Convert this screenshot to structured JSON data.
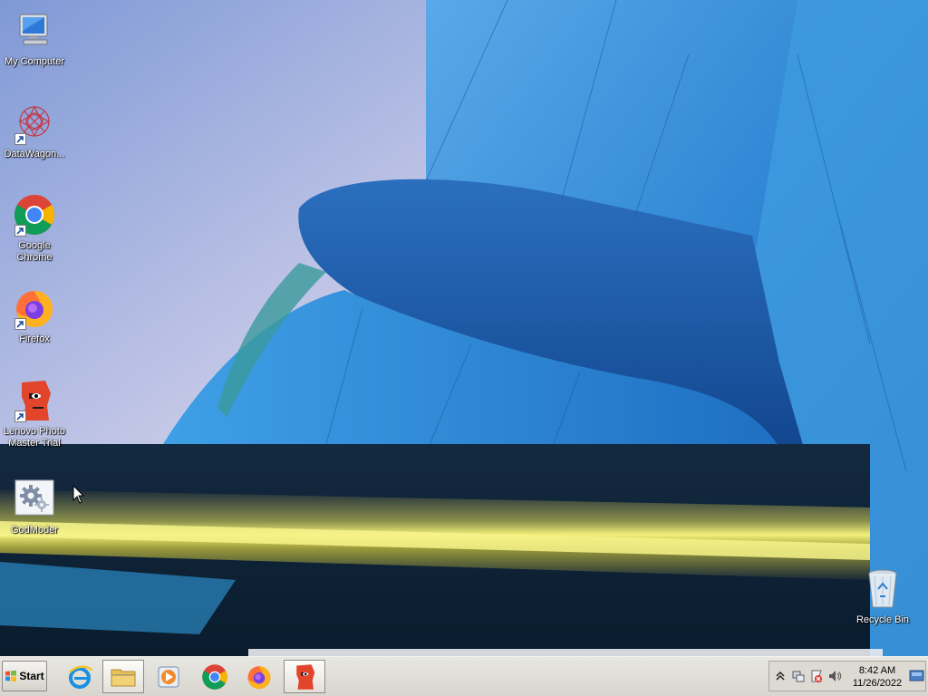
{
  "desktop": {
    "icons": [
      {
        "label": "My Computer",
        "icon": "computer-icon"
      },
      {
        "label": "DataWagon...",
        "icon": "datawagon-icon"
      },
      {
        "label": "Google Chrome",
        "icon": "chrome-icon"
      },
      {
        "label": "Firefox",
        "icon": "firefox-icon"
      },
      {
        "label": "Lenovo Photo Master Trial",
        "icon": "lenovo-photo-master-icon"
      },
      {
        "label": "GodModer",
        "icon": "settings-gears-icon"
      },
      {
        "label": "Recycle Bin",
        "icon": "recycle-bin-icon"
      }
    ]
  },
  "taskbar": {
    "start_label": "Start",
    "pinned": [
      {
        "name": "internet-explorer",
        "icon": "internet-explorer-icon"
      },
      {
        "name": "file-explorer",
        "icon": "folder-icon"
      },
      {
        "name": "media-player",
        "icon": "media-player-icon"
      },
      {
        "name": "google-chrome",
        "icon": "chrome-icon"
      },
      {
        "name": "firefox",
        "icon": "firefox-icon"
      },
      {
        "name": "lenovo-photo-master",
        "icon": "lenovo-photo-master-icon"
      }
    ]
  },
  "tray": {
    "time": "8:42 AM",
    "date": "11/26/2022",
    "icons": [
      "chevron-up-icon",
      "network-icon",
      "action-center-icon",
      "speaker-icon"
    ]
  },
  "colors": {
    "taskbar": "#d7d5cd",
    "building_blue": "#2f7fd0",
    "sky": "#b9c4e6"
  }
}
